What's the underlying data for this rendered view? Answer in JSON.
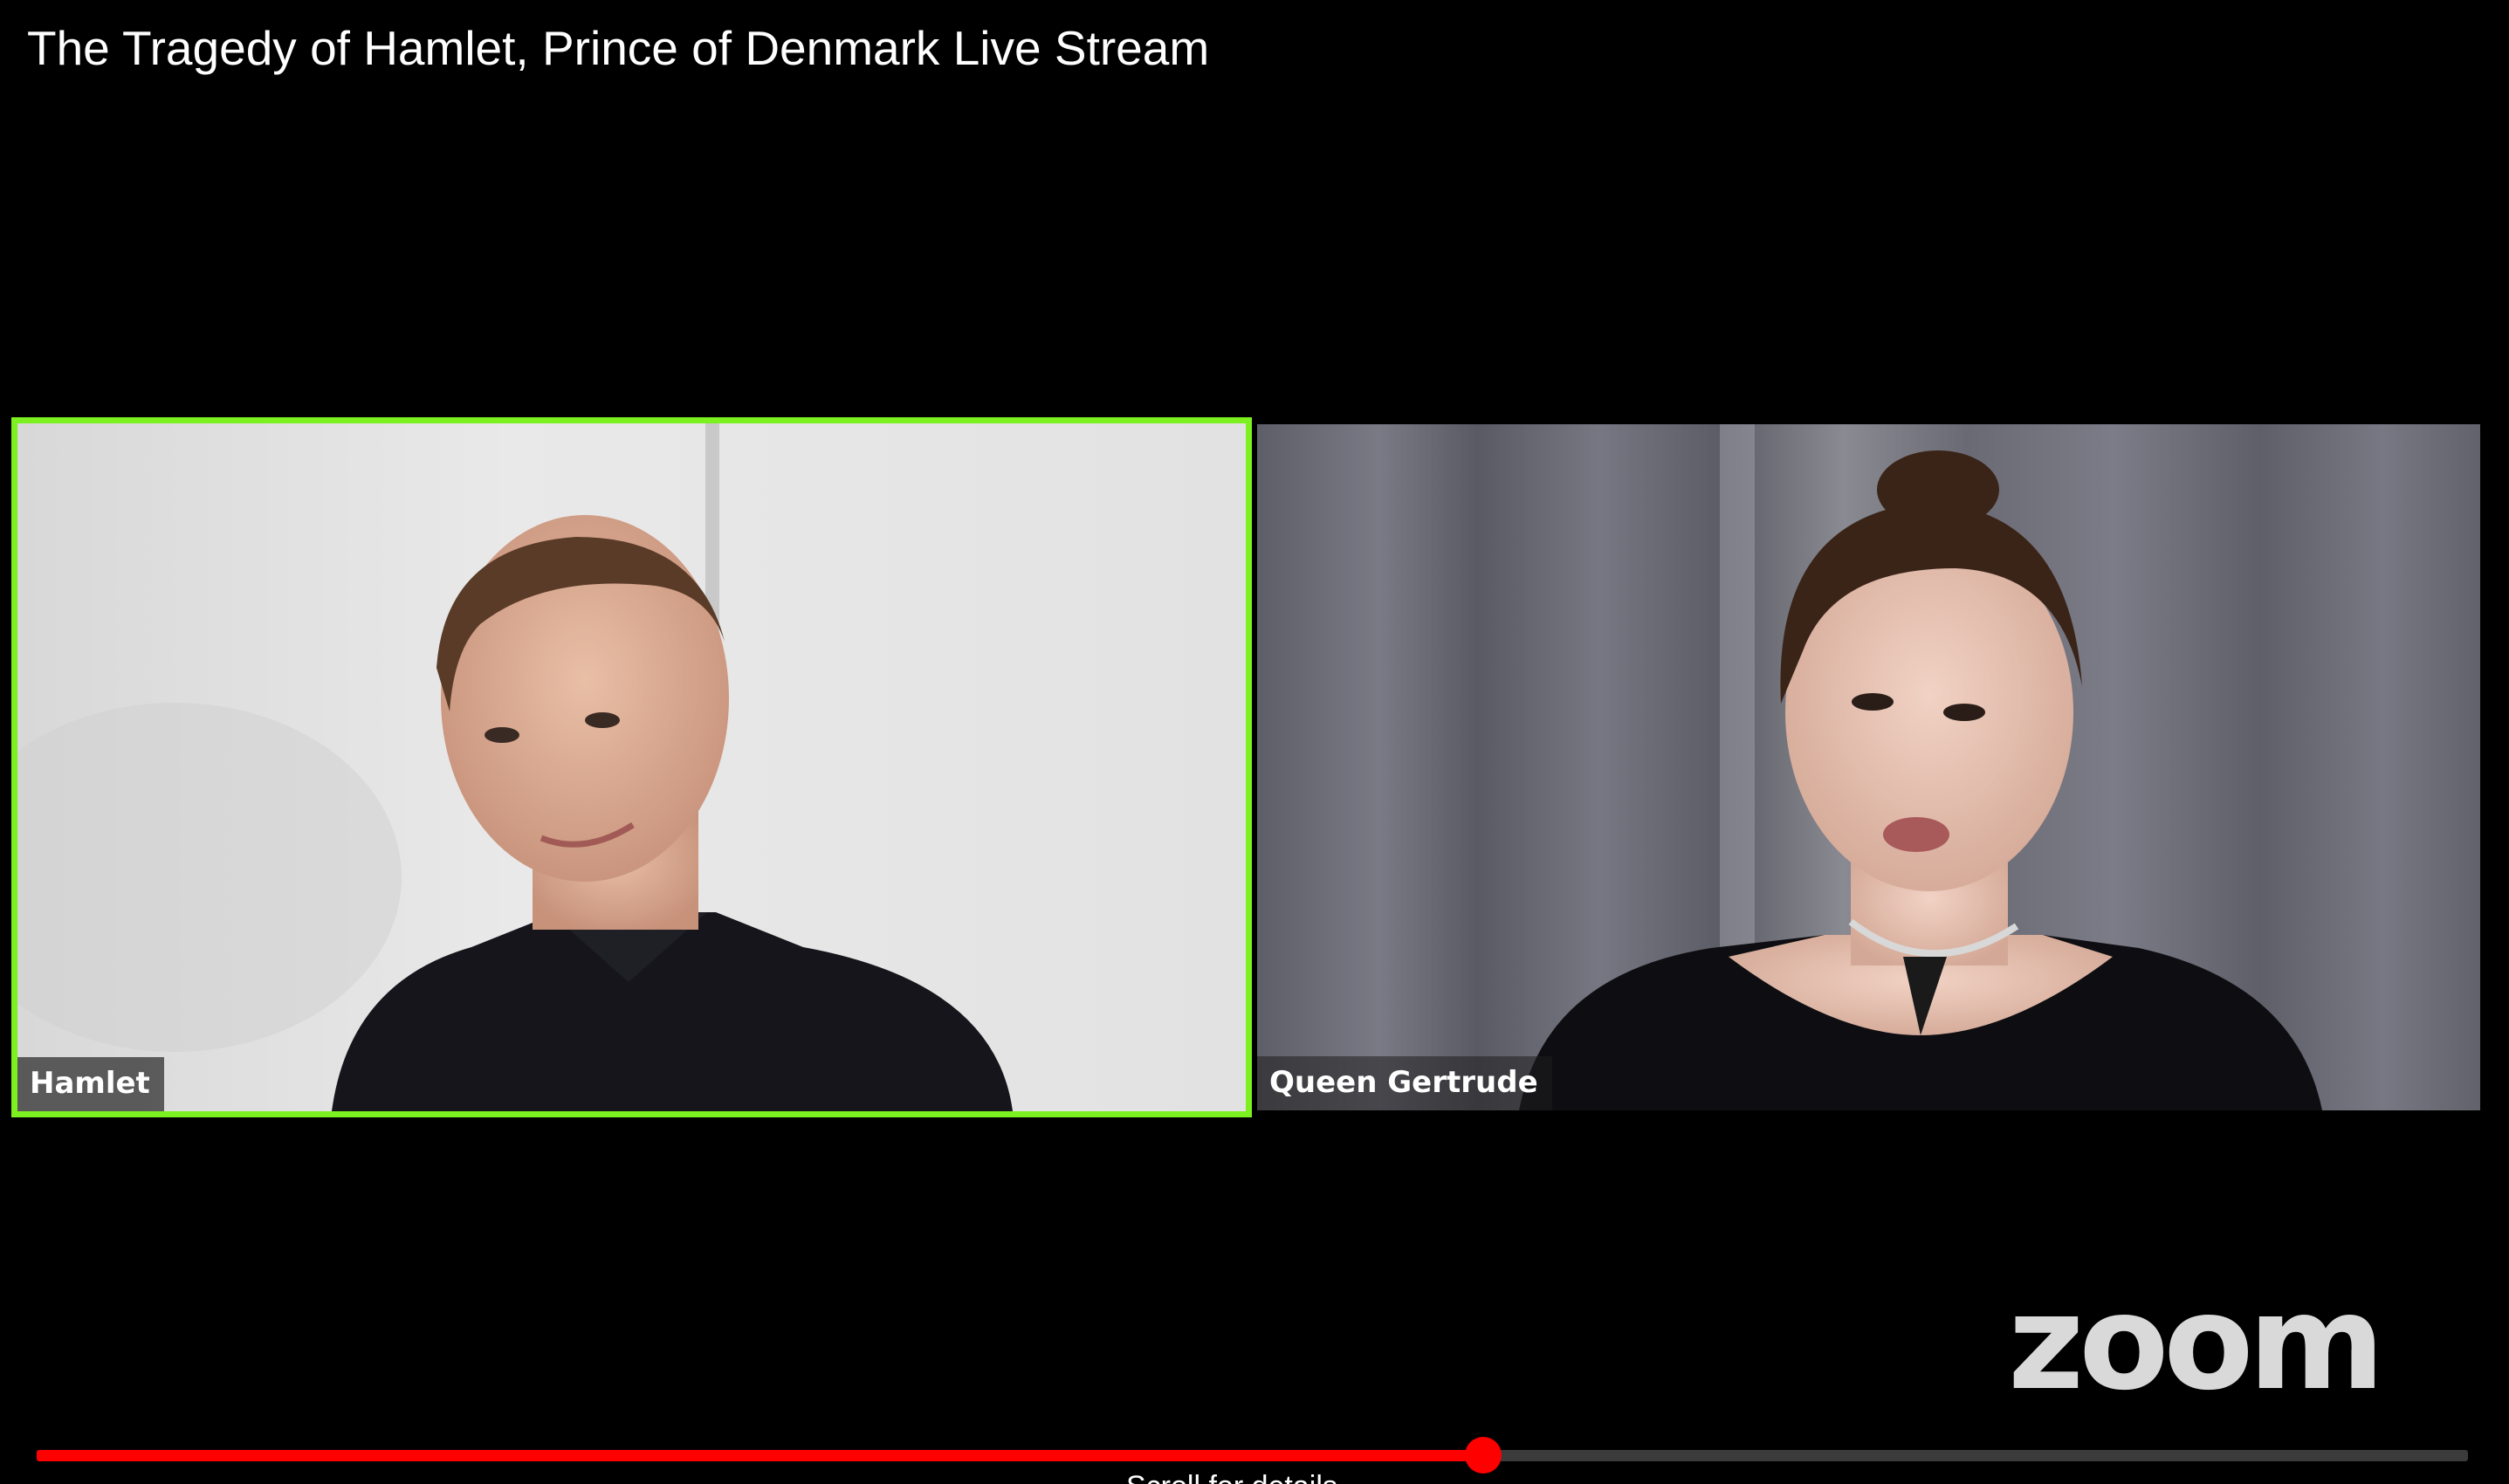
{
  "video": {
    "title": "The Tragedy of Hamlet, Prince of Denmark Live Stream"
  },
  "participants": [
    {
      "name": "Hamlet",
      "active_speaker": true
    },
    {
      "name": "Queen Gertrude",
      "active_speaker": false
    }
  ],
  "branding": {
    "logo_text": "zoom"
  },
  "player": {
    "progress_fraction": 0.595,
    "hint": "Scroll for details"
  },
  "colors": {
    "background": "#000000",
    "active_speaker_border": "#7df020",
    "progress_played": "#ff0000",
    "progress_track": "#3b3b3b",
    "logo": "#d9d9d9"
  }
}
